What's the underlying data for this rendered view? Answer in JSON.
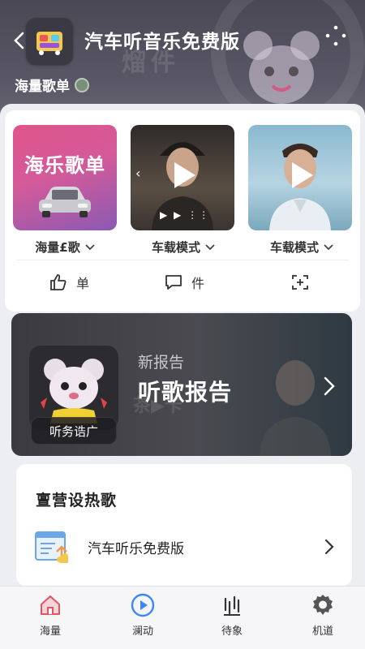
{
  "header": {
    "title": "汽车听音乐免费版",
    "background_text": "熘件",
    "subtitle": "海量歌单"
  },
  "tiles": [
    {
      "cover_text": "海乐歌单",
      "label": "海量£歌"
    },
    {
      "label": "车载模式",
      "controls": "▶ ▶ ⋮⋮"
    },
    {
      "label": "车载模式"
    }
  ],
  "actions": [
    {
      "label": "单",
      "icon": "thumbs-up-icon"
    },
    {
      "label": "件",
      "icon": "chat-bubble-icon"
    },
    {
      "label": "",
      "icon": "add-frame-icon"
    }
  ],
  "report": {
    "subtitle": "新报告",
    "title": "听歌报告",
    "tag": "听务诰广",
    "background_text": "茶▶卡"
  },
  "hot": {
    "title": "亶营设热歌",
    "item_label": "汽车听乐免费版"
  },
  "tabs": [
    {
      "label": "海量",
      "icon": "home-icon",
      "active": true
    },
    {
      "label": "澜动",
      "icon": "play-circle-icon"
    },
    {
      "label": "待象",
      "icon": "equalizer-icon"
    },
    {
      "label": "机道",
      "icon": "gear-icon"
    }
  ],
  "colors": {
    "accent": "#3a86ff",
    "header_bg": "#4a4855",
    "tile_pink": "#e0558a",
    "report_bg": "#3a3a40"
  }
}
